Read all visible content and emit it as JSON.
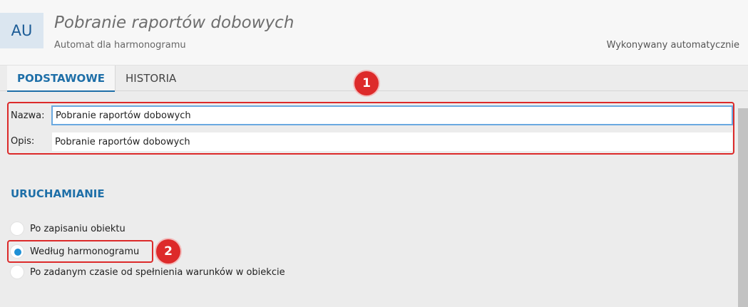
{
  "header": {
    "badge": "AU",
    "title": "Pobranie raportów dobowych",
    "subtitle": "Automat dla harmonogramu",
    "mode": "Wykonywany automatycznie"
  },
  "tabs": [
    {
      "label": "PODSTAWOWE",
      "active": true
    },
    {
      "label": "HISTORIA",
      "active": false
    }
  ],
  "form": {
    "name_label": "Nazwa:",
    "name_value": "Pobranie raportów dobowych",
    "desc_label": "Opis:",
    "desc_value": "Pobranie raportów dobowych"
  },
  "trigger": {
    "heading": "URUCHAMIANIE",
    "options": [
      {
        "label": "Po zapisaniu obiektu",
        "selected": false
      },
      {
        "label": "Według harmonogramu",
        "selected": true
      },
      {
        "label": "Po zadanym czasie od spełnienia warunków w obiekcie",
        "selected": false
      }
    ]
  },
  "annotations": [
    "1",
    "2"
  ],
  "colors": {
    "accent": "#1e6fa8",
    "highlight": "#dc2a2a",
    "radio": "#1d90d6"
  }
}
